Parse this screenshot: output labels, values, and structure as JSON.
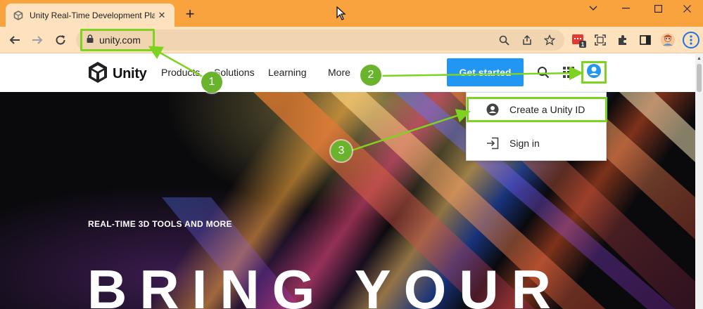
{
  "browser": {
    "tab": {
      "title": "Unity Real-Time Development Pla",
      "close": "✕"
    },
    "new_tab": "+",
    "window_controls": {
      "chevron": "⌄",
      "minimize": "—",
      "maximize": "☐",
      "close": "✕"
    },
    "address": {
      "url": "unity.com"
    },
    "extensions": {
      "badge_count": "1"
    },
    "colors": {
      "tabstrip": "#f9a33f",
      "toolbar": "#fde2bd",
      "annotation": "#7ed321"
    }
  },
  "site": {
    "logo_text": "Unity",
    "nav": [
      "Products",
      "Solutions",
      "Learning",
      "More"
    ],
    "cta": "Get started",
    "icons": [
      "search-icon",
      "apps-grid-icon",
      "account-circle-icon"
    ],
    "accent": "#2196f3"
  },
  "dropdown": {
    "items": [
      {
        "icon": "account-circle-icon",
        "label": "Create a Unity ID"
      },
      {
        "icon": "sign-in-icon",
        "label": "Sign in"
      }
    ]
  },
  "hero": {
    "eyebrow": "REAL-TIME 3D TOOLS AND MORE",
    "title": "BRING YOUR"
  },
  "annotations": [
    "1",
    "2",
    "3"
  ]
}
